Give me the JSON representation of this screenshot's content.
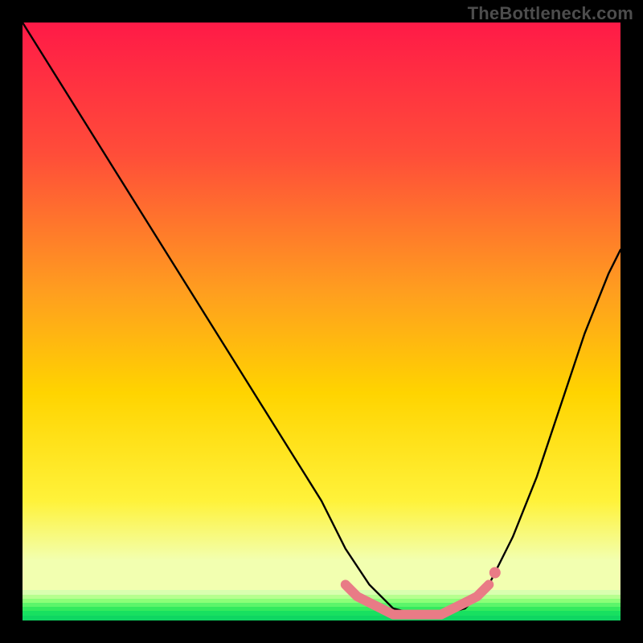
{
  "watermark": "TheBottleneck.com",
  "chart_data": {
    "type": "line",
    "title": "",
    "xlabel": "",
    "ylabel": "",
    "xlim": [
      0,
      100
    ],
    "ylim": [
      0,
      100
    ],
    "series": [
      {
        "name": "curve",
        "x": [
          0,
          5,
          10,
          15,
          20,
          25,
          30,
          35,
          40,
          45,
          50,
          54,
          58,
          62,
          66,
          70,
          74,
          78,
          82,
          86,
          90,
          94,
          98,
          100
        ],
        "values": [
          100,
          92,
          84,
          76,
          68,
          60,
          52,
          44,
          36,
          28,
          20,
          12,
          6,
          2,
          1,
          1,
          2,
          6,
          14,
          24,
          36,
          48,
          58,
          62
        ]
      }
    ],
    "markers": {
      "name": "pink-segment",
      "color": "#e97b86",
      "x": [
        54,
        56,
        58,
        60,
        62,
        64,
        66,
        68,
        70,
        72,
        74,
        76,
        78
      ],
      "values": [
        6,
        4,
        3,
        2,
        1,
        1,
        1,
        1,
        1,
        2,
        3,
        4,
        6
      ]
    },
    "colors": {
      "gradient_top": "#ff1a47",
      "gradient_upper_mid": "#ff6a2a",
      "gradient_mid": "#ffd400",
      "gradient_lower_mid": "#f6ff5a",
      "gradient_bottom": "#10e060",
      "curve": "#000000",
      "marker": "#e97b86",
      "frame": "#000000"
    }
  }
}
